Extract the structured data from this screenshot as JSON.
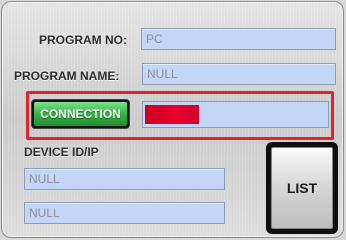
{
  "program_no": {
    "label": "PROGRAM NO:",
    "value": "PC"
  },
  "program_name": {
    "label": "PROGRAM NAME:",
    "value": "NULL"
  },
  "connection": {
    "button_label": "CONNECTION",
    "progress_fraction": 0.3,
    "accent_color": "#e0242e",
    "progress_color": "#e8002a",
    "button_color": "#34b545"
  },
  "device": {
    "label": "DEVICE ID/IP",
    "id_value": "NULL",
    "ip_value": "NULL"
  },
  "list_button": {
    "label": "LIST"
  }
}
